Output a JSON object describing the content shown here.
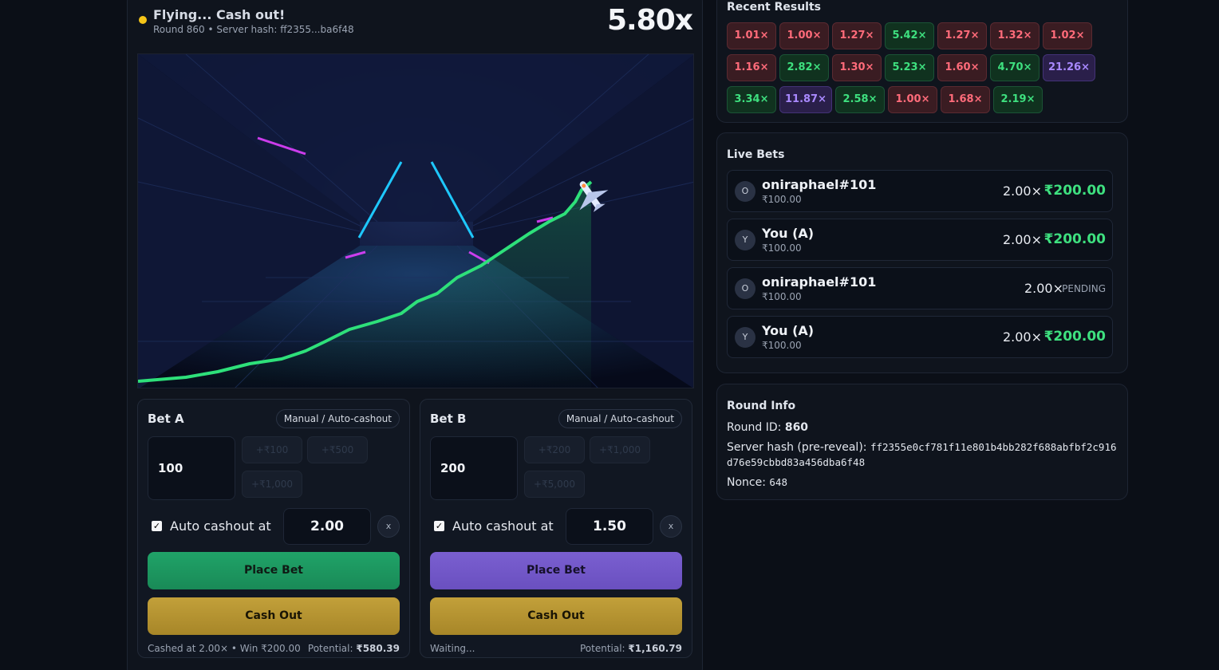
{
  "header": {
    "status_title": "Flying... Cash out!",
    "round_line": "Round 860 • Server hash: ff2355...ba6f48",
    "multiplier": "5.80x"
  },
  "colors": {
    "accent_green": "#22c55e",
    "accent_purple": "#7c5cd6",
    "accent_gold": "#c2a03a",
    "status_dot": "#f5c518"
  },
  "game": {
    "plane_icon": "airplane-icon"
  },
  "bet_a": {
    "title": "Bet A",
    "mode": "Manual / Auto-cashout",
    "amount": "100",
    "chips": [
      "+₹100",
      "+₹500",
      "+₹1,000"
    ],
    "auto_checked": true,
    "auto_label": "Auto cashout at",
    "auto_value": "2.00",
    "clear": "x",
    "place": "Place Bet",
    "cashout": "Cash Out",
    "status": "Cashed at 2.00× • Win ₹200.00",
    "potential_label": "Potential:",
    "potential_value": "₹580.39"
  },
  "bet_b": {
    "title": "Bet B",
    "mode": "Manual / Auto-cashout",
    "amount": "200",
    "chips": [
      "+₹200",
      "+₹1,000",
      "+₹5,000"
    ],
    "auto_checked": true,
    "auto_label": "Auto cashout at",
    "auto_value": "1.50",
    "clear": "x",
    "place": "Place Bet",
    "cashout": "Cash Out",
    "status": "Waiting...",
    "potential_label": "Potential:",
    "potential_value": "₹1,160.79"
  },
  "recent": {
    "title": "Recent Results",
    "items": [
      {
        "v": "1.01×",
        "c": "red"
      },
      {
        "v": "1.00×",
        "c": "red"
      },
      {
        "v": "1.27×",
        "c": "red"
      },
      {
        "v": "5.42×",
        "c": "green"
      },
      {
        "v": "1.27×",
        "c": "red"
      },
      {
        "v": "1.32×",
        "c": "red"
      },
      {
        "v": "1.02×",
        "c": "red"
      },
      {
        "v": "1.16×",
        "c": "red"
      },
      {
        "v": "2.82×",
        "c": "green"
      },
      {
        "v": "1.30×",
        "c": "red"
      },
      {
        "v": "5.23×",
        "c": "green"
      },
      {
        "v": "1.60×",
        "c": "red"
      },
      {
        "v": "4.70×",
        "c": "green"
      },
      {
        "v": "21.26×",
        "c": "purple"
      },
      {
        "v": "3.34×",
        "c": "green"
      },
      {
        "v": "11.87×",
        "c": "purple"
      },
      {
        "v": "2.58×",
        "c": "green"
      },
      {
        "v": "1.00×",
        "c": "red"
      },
      {
        "v": "1.68×",
        "c": "red"
      },
      {
        "v": "2.19×",
        "c": "green"
      }
    ]
  },
  "live": {
    "title": "Live Bets",
    "rows": [
      {
        "initial": "O",
        "name": "oniraphael#101",
        "stake": "₹100.00",
        "mult": "2.00×",
        "win": "₹200.00",
        "pending": ""
      },
      {
        "initial": "Y",
        "name": "You (A)",
        "stake": "₹100.00",
        "mult": "2.00×",
        "win": "₹200.00",
        "pending": ""
      },
      {
        "initial": "O",
        "name": "oniraphael#101",
        "stake": "₹100.00",
        "mult": "2.00×",
        "win": "",
        "pending": "PENDING"
      },
      {
        "initial": "Y",
        "name": "You (A)",
        "stake": "₹100.00",
        "mult": "2.00×",
        "win": "₹200.00",
        "pending": ""
      }
    ]
  },
  "round_info": {
    "title": "Round Info",
    "round_label": "Round ID:",
    "round_id": "860",
    "hash_label": "Server hash (pre-reveal):",
    "hash_line1": "ff2355e0cf781f11e801b4bb282f688abfbf2c916",
    "hash_line2": "d76e59cbbd83a456dba6f48",
    "nonce_label": "Nonce:",
    "nonce": "648"
  }
}
